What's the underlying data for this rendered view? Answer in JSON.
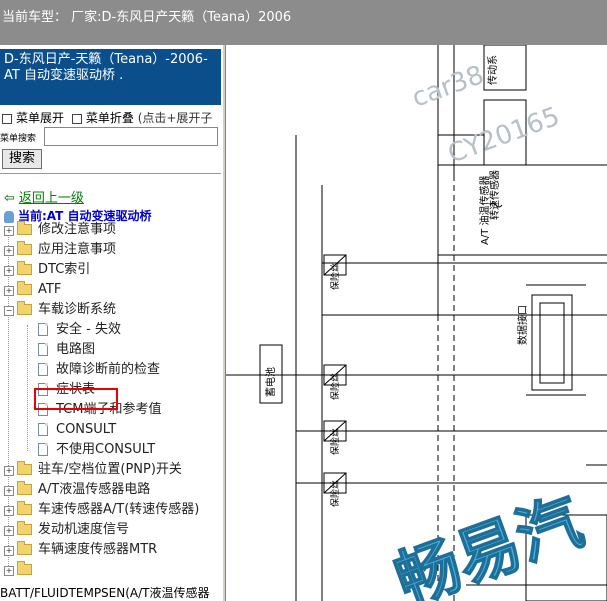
{
  "top_bar": {
    "title": "当前车型： 厂家:D-东风日产天籁（Teana）2006"
  },
  "vehicle_box": {
    "text": "D-东风日产-天籁（Teana）-2006- AT 自动变速驱动桥 ."
  },
  "menu": {
    "expand": "菜单展开",
    "collapse": "菜单折叠",
    "hint": "(点击+展开子"
  },
  "search": {
    "label": "菜单搜索",
    "value": "",
    "button": "搜索"
  },
  "nav": {
    "back": "返回上一级",
    "current": "当前:AT 自动变速驱动桥"
  },
  "tree": [
    {
      "label": "修改注意事项",
      "type": "folder"
    },
    {
      "label": "应用注意事项",
      "type": "folder"
    },
    {
      "label": "DTC索引",
      "type": "folder"
    },
    {
      "label": "ATF",
      "type": "folder"
    },
    {
      "label": "车载诊断系统",
      "type": "folder",
      "expanded": true
    },
    {
      "label": "安全 - 失效",
      "type": "doc"
    },
    {
      "label": "电路图",
      "type": "doc",
      "highlighted": true
    },
    {
      "label": "故障诊断前的检查",
      "type": "doc"
    },
    {
      "label": "症状表",
      "type": "doc"
    },
    {
      "label": "TCM端子和参考值",
      "type": "doc"
    },
    {
      "label": "CONSULT",
      "type": "doc"
    },
    {
      "label": "不使用CONSULT",
      "type": "doc"
    },
    {
      "label": "驻车/空档位置(PNP)开关",
      "type": "folder"
    },
    {
      "label": "A/T液温传感器电路",
      "type": "folder"
    },
    {
      "label": "车速传感器A/T(转速传感器)",
      "type": "folder"
    },
    {
      "label": "发动机速度信号",
      "type": "folder"
    },
    {
      "label": "车辆速度传感器MTR",
      "type": "folder"
    },
    {
      "label": "",
      "type": "folder"
    }
  ],
  "bottom_text": "BATT/FLUIDTEMPSEN(A/T液温传感器",
  "diagram": {
    "labels": {
      "turbine": "转速传感器",
      "fluid_temp": "A/T 油温传感器",
      "data_link": "数据接口",
      "battery": "蓄电池",
      "fuse": "保险丝",
      "top_partial": "传动系"
    },
    "watermarks": {
      "site": "car38",
      "code": "CY20165",
      "brand": "畅易汽"
    }
  },
  "colors": {
    "top_bar": "#8c8c8c",
    "vehicle_box": "#0a4f8c",
    "highlight": "#e00000",
    "watermark": "#4ab0d8"
  }
}
